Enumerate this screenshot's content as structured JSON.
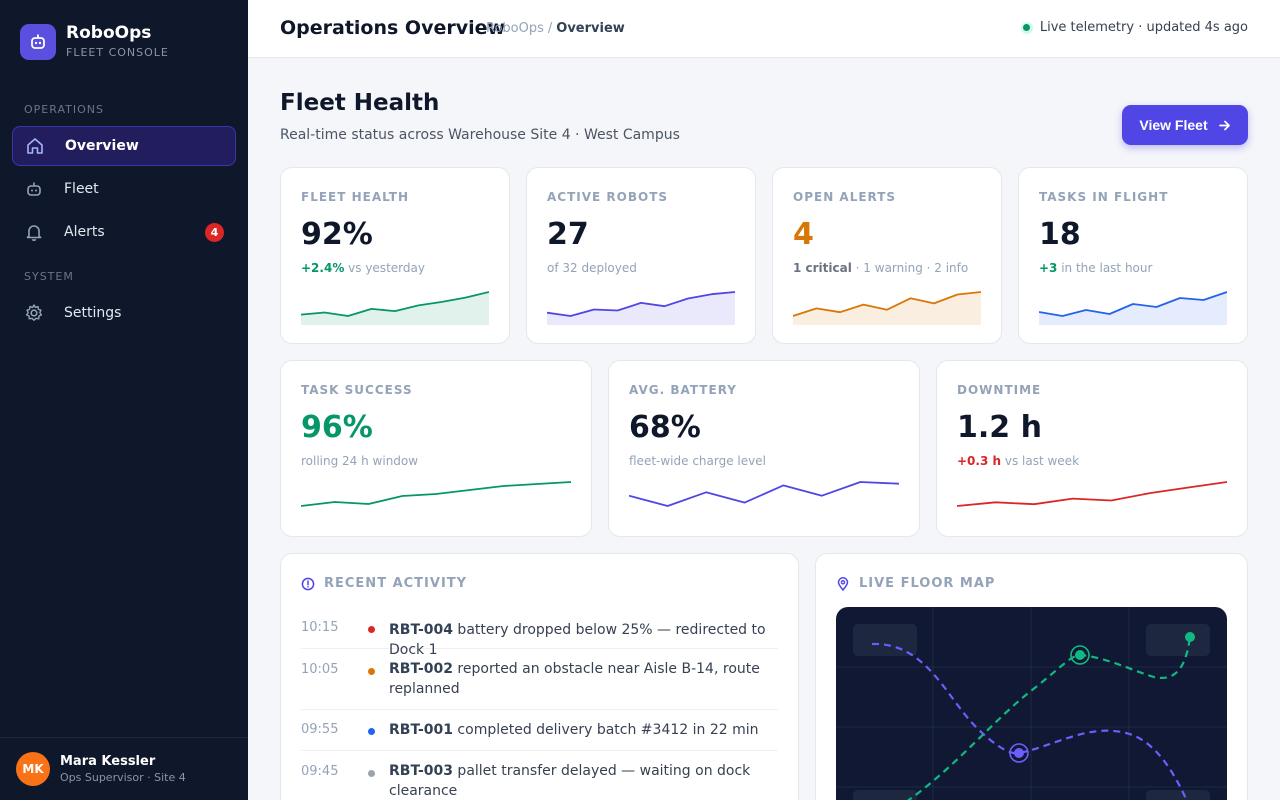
{
  "brand": {
    "name": "RoboOps",
    "subtitle": "FLEET CONSOLE"
  },
  "sidebar": {
    "sections": [
      {
        "title": "OPERATIONS"
      },
      {
        "title": "SYSTEM"
      }
    ],
    "items": [
      {
        "label": "Overview",
        "icon": "home-icon",
        "active": true
      },
      {
        "label": "Fleet",
        "icon": "robot-icon"
      },
      {
        "label": "Alerts",
        "icon": "bell-icon",
        "badge": "4"
      },
      {
        "label": "Settings",
        "icon": "gear-icon"
      }
    ]
  },
  "user": {
    "initials": "MK",
    "name": "Mara Kessler",
    "role": "Ops Supervisor · Site 4"
  },
  "topbar": {
    "title": "Operations Overview",
    "breadcrumb": {
      "root": "RoboOps",
      "sep": "/",
      "current": "Overview"
    },
    "status": "Live telemetry · updated 4s ago"
  },
  "header": {
    "title": "Fleet Health",
    "subtitle": "Real-time status across Warehouse Site 4 · West Campus",
    "button": "View Fleet"
  },
  "kpis": [
    {
      "label": "FLEET HEALTH",
      "value": "92%",
      "delta": "+2.4%",
      "sub": " vs yesterday",
      "color": "#059669",
      "trend": [
        52,
        55,
        50,
        60,
        57,
        65,
        70,
        76,
        84
      ]
    },
    {
      "label": "ACTIVE ROBOTS",
      "value": "27",
      "delta": "",
      "sub": "of 32 deployed",
      "color": "#4f46e5",
      "trend": [
        45,
        42,
        48,
        47,
        54,
        51,
        58,
        62,
        64
      ]
    },
    {
      "label": "OPEN ALERTS",
      "value": "4",
      "delta": "1 critical",
      "sub": " · 1 warning · 2 info",
      "color": "#d97706",
      "trend": [
        40,
        52,
        46,
        58,
        50,
        68,
        60,
        74,
        78
      ]
    },
    {
      "label": "TASKS IN FLIGHT",
      "value": "18",
      "delta": "+3",
      "sub": " in the last hour",
      "color": "#2563eb",
      "trend": [
        50,
        46,
        52,
        48,
        58,
        55,
        64,
        62,
        70
      ]
    },
    {
      "label": "TASK SUCCESS",
      "value": "96%",
      "delta": "",
      "sub": "rolling 24 h window",
      "color": "#059669",
      "trend": [
        50,
        54,
        52,
        60,
        62,
        66,
        70,
        72,
        74
      ]
    },
    {
      "label": "AVG. BATTERY",
      "value": "68%",
      "delta": "",
      "sub": "fleet-wide charge level",
      "color": "#4f46e5",
      "trend": [
        56,
        50,
        58,
        52,
        62,
        56,
        64,
        63
      ]
    },
    {
      "label": "DOWNTIME",
      "value": "1.2 h",
      "delta": "+0.3 h",
      "sub": " vs last week",
      "color": "#dc2626",
      "trend": [
        46,
        50,
        48,
        54,
        52,
        60,
        66,
        72
      ]
    }
  ],
  "activity": {
    "title": "RECENT ACTIVITY",
    "rows": [
      {
        "time": "10:15",
        "robot": "RBT-004",
        "text": " battery dropped below 25% — redirected to Dock 1",
        "color": "#dc2626"
      },
      {
        "time": "10:05",
        "robot": "RBT-002",
        "text": " reported an obstacle near Aisle B-14, route replanned",
        "color": "#d97706"
      },
      {
        "time": "09:55",
        "robot": "RBT-001",
        "text": " completed delivery batch #3412 in 22 min",
        "color": "#2563eb"
      },
      {
        "time": "09:45",
        "robot": "RBT-003",
        "text": " pallet transfer delayed — waiting on dock clearance",
        "color": "#9ca3af"
      }
    ]
  },
  "floor_map": {
    "title": "LIVE FLOOR MAP"
  }
}
